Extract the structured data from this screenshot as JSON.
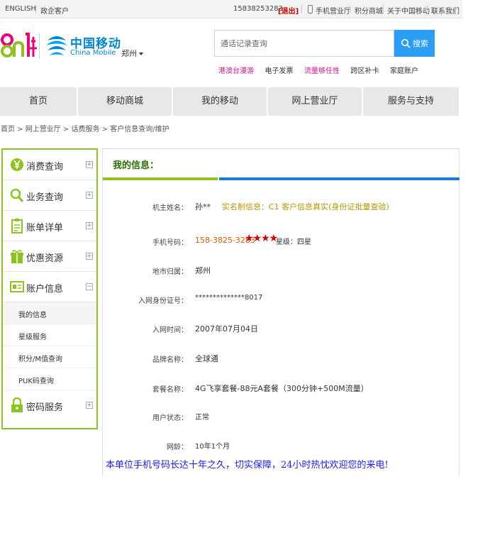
{
  "topbar": {
    "english": "ENGLISH",
    "enterprise": "政企客户",
    "phone": "15838253283",
    "logout": "[退出]",
    "mobile_hall": "手机营业厅",
    "points_mall": "积分商城",
    "about": "关于中国移动",
    "contact": "联系我们"
  },
  "header": {
    "brand_cn": "中国移动",
    "brand_en": "China Mobile",
    "city": "郑州",
    "search_placeholder": "通话记录查询",
    "search_button": "搜索",
    "hotlinks": [
      {
        "label": "港澳台漫游",
        "color": "#c8168c"
      },
      {
        "label": "电子发票",
        "color": "#333333"
      },
      {
        "label": "流量够任性",
        "color": "#c8168c"
      },
      {
        "label": "跨区补卡",
        "color": "#333333"
      },
      {
        "label": "家庭账户",
        "color": "#333333"
      }
    ]
  },
  "nav": [
    "首页",
    "移动商城",
    "我的移动",
    "网上营业厅",
    "服务与支持"
  ],
  "breadcrumb": "首页 > 网上营业厅 > 话费服务 > 客户信息查询/维护",
  "sidebar": {
    "items": [
      {
        "label": "消费查询",
        "icon": "yen-icon"
      },
      {
        "label": "业务查询",
        "icon": "magnifier-icon"
      },
      {
        "label": "账单详单",
        "icon": "bill-icon"
      },
      {
        "label": "优惠资源",
        "icon": "gift-icon"
      },
      {
        "label": "账户信息",
        "icon": "id-card-icon"
      },
      {
        "label": "密码服务",
        "icon": "lock-icon"
      }
    ],
    "sub_items": [
      "我的信息",
      "星级服务",
      "积分/M值查询",
      "PUK码查询"
    ]
  },
  "panel": {
    "title": "我的信息：",
    "rows": {
      "owner_label": "机主姓名：",
      "owner_value": "孙**",
      "realname_note": "实名制信息：C1 客户信息真实(身份证批量查验）",
      "phone_label": "手机号码：",
      "phone_value": "158-3825-3283",
      "stars": "★★★★",
      "star_level": "星级：四星",
      "region_label": "地市归属：",
      "region_value": "郑州",
      "id_label": "入网身份证号：",
      "id_value": "**************8017",
      "join_label": "入网时间：",
      "join_value": "2007年07月04日",
      "brand_label": "品牌名称：",
      "brand_value": "全球通",
      "plan_label": "套餐名称：",
      "plan_value": "4G飞享套餐-88元A套餐（300分钟+500M流量）",
      "status_label": "用户状态：",
      "status_value": "正常",
      "age_label": "网龄：",
      "age_value": "10年1个月"
    }
  },
  "bottom_note": "本单位手机号码长达十年之久，切实保障，24小时热忱欢迎您的来电!",
  "colors": {
    "green": "#8dc21f",
    "blue": "#1b7bd1",
    "search_blue": "#2a9df4",
    "logout_red": "#d10000"
  }
}
